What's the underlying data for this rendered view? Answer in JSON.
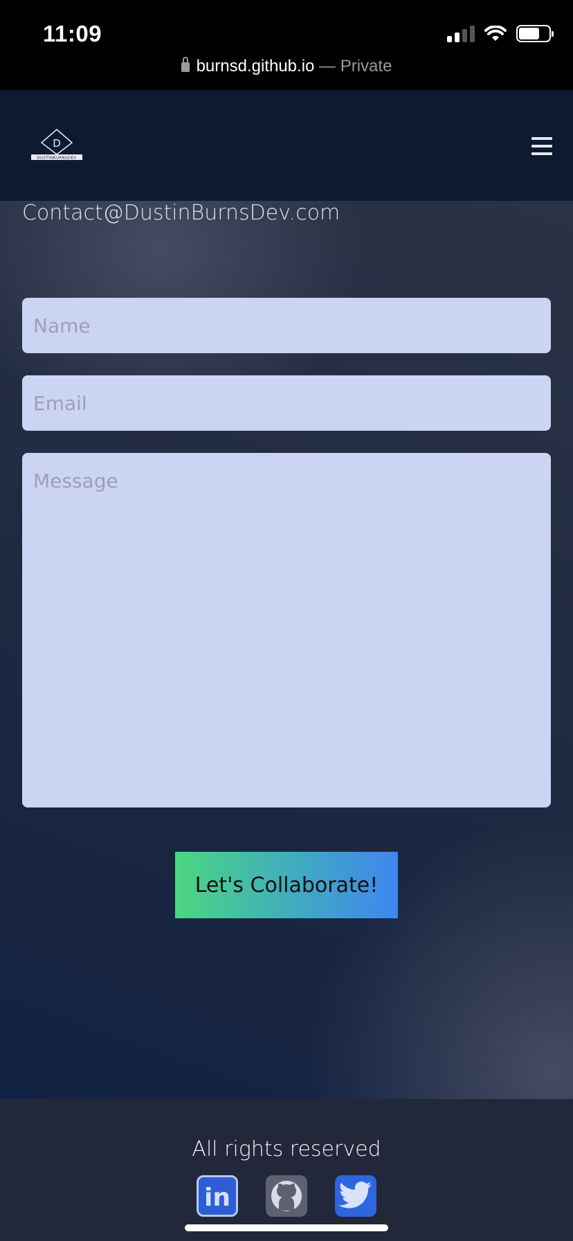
{
  "status_bar": {
    "time": "11:09",
    "signal_icon": "cellular-signal-icon",
    "wifi_icon": "wifi-icon",
    "battery_icon": "battery-icon"
  },
  "browser": {
    "url": "burnsd.github.io",
    "separator": "—",
    "mode": "Private",
    "lock_icon": "lock-icon"
  },
  "navbar": {
    "logo_letter": "D",
    "logo_wordmark": "DUSTINBURNSDEV",
    "menu_icon": "hamburger-menu-icon"
  },
  "contact": {
    "email": "Contact@DustinBurnsDev.com",
    "form": {
      "name_placeholder": "Name",
      "name_value": "",
      "email_placeholder": "Email",
      "email_value": "",
      "message_placeholder": "Message",
      "message_value": "",
      "submit_label": "Let's Collaborate!"
    }
  },
  "footer": {
    "rights": "All rights reserved",
    "socials": [
      {
        "name": "linkedin",
        "icon": "linkedin-icon",
        "label": "in"
      },
      {
        "name": "github",
        "icon": "github-icon"
      },
      {
        "name": "twitter",
        "icon": "twitter-icon"
      }
    ]
  },
  "colors": {
    "navbar_bg": "#0d1a30",
    "field_bg": "#ccd4f4",
    "button_gradient_start": "#4bd77f",
    "button_gradient_end": "#3f86f0",
    "footer_bg": "#222839"
  }
}
